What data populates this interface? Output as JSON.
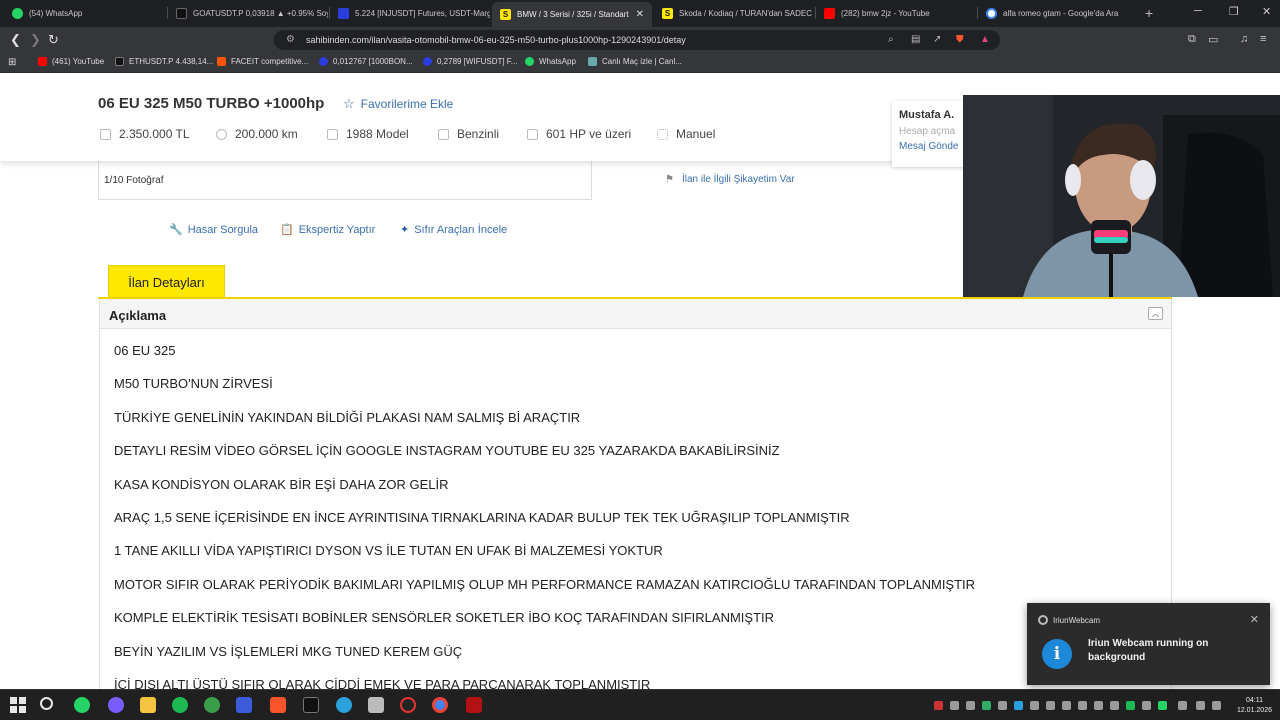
{
  "browser": {
    "tabs": [
      {
        "label": "(54) WhatsApp",
        "color": "#25d366",
        "active": false
      },
      {
        "label": "GOATUSDT.P 0,03918 ▲ +0.95% Soy",
        "color": "#1a1a1a",
        "active": false
      },
      {
        "label": "5.224 [INJUSDT] Futures, USDT-Marg",
        "color": "#2a3ee0",
        "active": false
      },
      {
        "label": "BMW / 3 Serisi / 325i / Standart",
        "color": "#ffe800",
        "active": true
      },
      {
        "label": "Skoda / Kodiaq / TURAN'dan SADEC",
        "color": "#ffe800",
        "active": false
      },
      {
        "label": "(282) bmw 2jz - YouTube",
        "color": "#ff0000",
        "active": false
      },
      {
        "label": "alfa romeo gtam - Google'da Ara",
        "color": "#4285f4",
        "active": false
      }
    ],
    "url": "sahibinden.com/ilan/vasita-otomobil-bmw-06-eu-325-m50-turbo-plus1000hp-1290243901/detay",
    "bookmarks": [
      {
        "label": "(461) YouTube",
        "color": "#ff0000"
      },
      {
        "label": "ETHUSDT.P 4.438,14...",
        "color": "#1a1a1a"
      },
      {
        "label": "FACEIT competitive...",
        "color": "#ff5500"
      },
      {
        "label": "0,012767 [1000BON...",
        "color": "#2a3ee0"
      },
      {
        "label": "0,2789 [WIFUSDT] F...",
        "color": "#2a3ee0"
      },
      {
        "label": "WhatsApp",
        "color": "#25d366"
      },
      {
        "label": "Canlı Maç izle | Canl...",
        "color": "#6aa"
      }
    ]
  },
  "listing": {
    "title": "06 EU 325 M50 TURBO +1000hp",
    "favorite_label": "Favorilerime Ekle",
    "specs": {
      "price": "2.350.000 TL",
      "km": "200.000 km",
      "year": "1988 Model",
      "fuel": "Benzinli",
      "power": "601 HP ve üzeri",
      "gear": "Manuel"
    },
    "photo_count": "1/10 Fotoğraf",
    "complaint": "İlan ile İlgili Şikayetim Var",
    "actions": {
      "damage": "Hasar Sorgula",
      "expertise": "Ekspertiz Yaptır",
      "new_cars": "Sıfır Araçları İncele"
    },
    "details_tab": "İlan Detayları",
    "description_title": "Açıklama",
    "description_lines": [
      "06 EU 325",
      "M50 TURBO'NUN ZİRVESİ",
      "TÜRKİYE GENELİNİN YAKINDAN BİLDİĞİ PLAKASI NAM SALMIŞ Bİ ARAÇTIR",
      "DETAYLI RESİM VİDEO GÖRSEL İÇİN GOOGLE INSTAGRAM YOUTUBE EU 325 YAZARAKDA BAKABİLİRSİNİZ",
      "KASA KONDİSYON OLARAK BİR EŞİ DAHA ZOR GELİR",
      "ARAÇ 1,5 SENE İÇERİSİNDE EN İNCE AYRINTISINA TIRNAKLARINA KADAR BULUP TEK TEK UĞRAŞILIP TOPLANMIŞTIR",
      "1 TANE AKILLI VİDA YAPIŞTIRICI DYSON VS İLE TUTAN EN UFAK Bİ MALZEMESİ YOKTUR",
      "MOTOR SIFIR OLARAK PERİYODİK BAKIMLARI YAPILMIŞ OLUP MH PERFORMANCE RAMAZAN KATIRCIOĞLU TARAFINDAN TOPLANMIŞTIR",
      "KOMPLE ELEKTİRİK TESİSATI BOBİNLER SENSÖRLER SOKETLER İBO KOÇ TARAFINDAN SIFIRLANMIŞTIR",
      "BEYİN YAZILIM VS İŞLEMLERİ MKG TUNED KEREM GÜÇ",
      "İÇİ DIŞI ALTI ÜSTÜ SIFIR OLARAK CİDDİ EMEK VE PARA PARCANARAK TOPLANMIŞTIR"
    ]
  },
  "seller": {
    "name": "Mustafa A.",
    "sub": "Hesap açma",
    "message": "Mesaj Gönde"
  },
  "notification": {
    "app": "IriunWebcam",
    "message": "Iriun Webcam running on background"
  },
  "taskbar": {
    "time": "04:11",
    "date": "12.01.2026"
  }
}
